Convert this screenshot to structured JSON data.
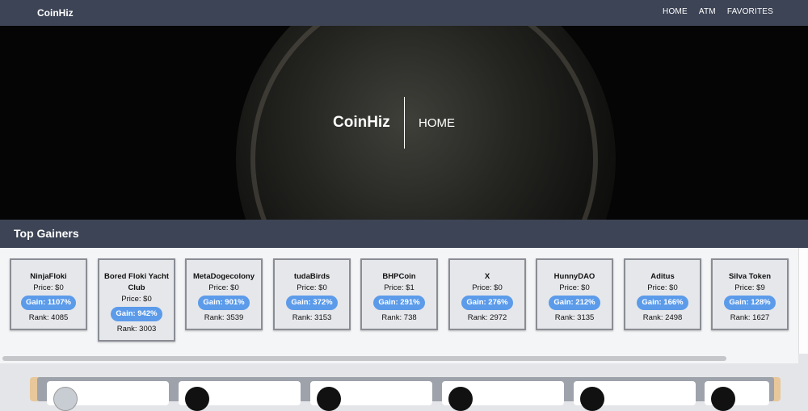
{
  "nav": {
    "brand": "CoinHiz",
    "links": [
      "HOME",
      "ATM",
      "FAVORITES"
    ]
  },
  "hero": {
    "title": "CoinHiz",
    "subtitle": "HOME"
  },
  "top_gainers": {
    "title": "Top Gainers",
    "cards": [
      {
        "name": "NinjaFloki",
        "price": "Price: $0",
        "gain": "Gain: 1107%",
        "rank": "Rank: 4085"
      },
      {
        "name": "Bored Floki Yacht Club",
        "price": "Price: $0",
        "gain": "Gain: 942%",
        "rank": "Rank: 3003"
      },
      {
        "name": "MetaDogecolony",
        "price": "Price: $0",
        "gain": "Gain: 901%",
        "rank": "Rank: 3539"
      },
      {
        "name": "tudaBirds",
        "price": "Price: $0",
        "gain": "Gain: 372%",
        "rank": "Rank: 3153"
      },
      {
        "name": "BHPCoin",
        "price": "Price: $1",
        "gain": "Gain: 291%",
        "rank": "Rank: 738"
      },
      {
        "name": "X",
        "price": "Price: $0",
        "gain": "Gain: 276%",
        "rank": "Rank: 2972"
      },
      {
        "name": "HunnyDAO",
        "price": "Price: $0",
        "gain": "Gain: 212%",
        "rank": "Rank: 3135"
      },
      {
        "name": "Aditus",
        "price": "Price: $0",
        "gain": "Gain: 166%",
        "rank": "Rank: 2498"
      },
      {
        "name": "Silva Token",
        "price": "Price: $9",
        "gain": "Gain: 128%",
        "rank": "Rank: 1627"
      }
    ]
  },
  "colors": {
    "nav_bg": "#3d4455",
    "gain_badge": "#5b9bea",
    "panel_accent": "#e8c79a"
  }
}
